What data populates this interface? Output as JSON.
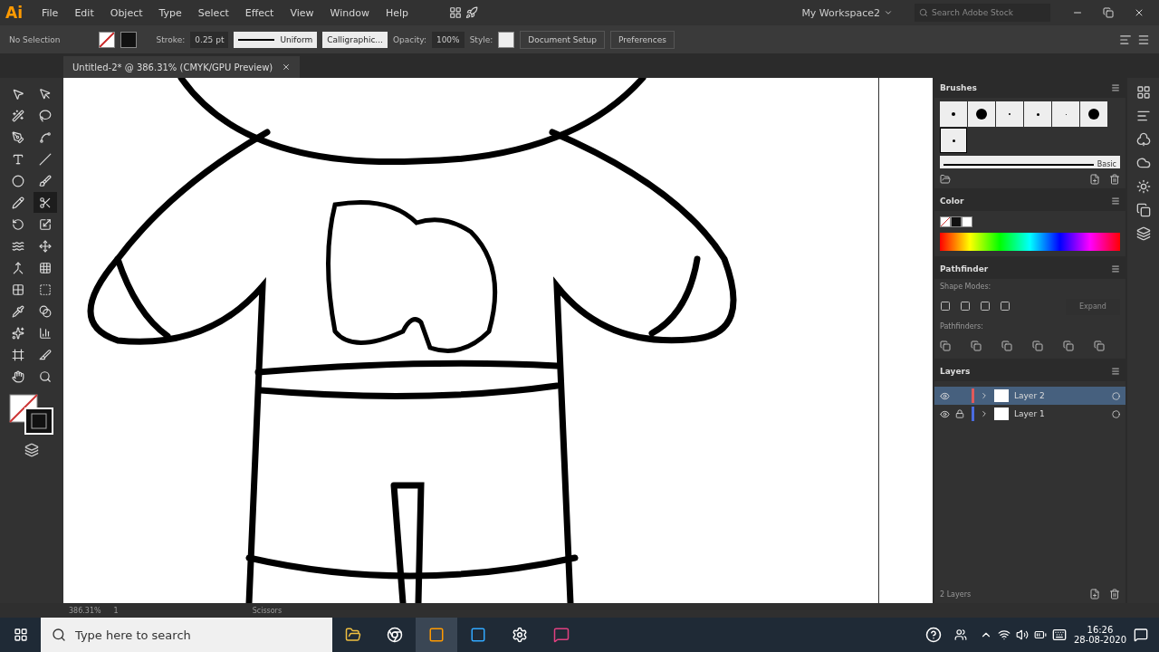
{
  "menu_bar": {
    "logo": "Ai",
    "items": [
      "File",
      "Edit",
      "Object",
      "Type",
      "Select",
      "Effect",
      "View",
      "Window",
      "Help"
    ],
    "workspace": "My Workspace2",
    "search": {
      "placeholder": "Search Adobe Stock"
    }
  },
  "control_bar": {
    "selection": "No Selection",
    "stroke_label": "Stroke:",
    "stroke_value": "0.25 pt",
    "profile": "Uniform",
    "brush": "Calligraphic...",
    "opacity_label": "Opacity:",
    "opacity": "100%",
    "style_label": "Style:",
    "buttons": [
      "Document Setup",
      "Preferences"
    ]
  },
  "document_tab": {
    "title": "Untitled-2* @ 386.31% (CMYK/GPU Preview)"
  },
  "tools": [
    {
      "kind": "select",
      "selected": false
    },
    {
      "kind": "direct",
      "selected": false
    },
    {
      "kind": "wand",
      "selected": false
    },
    {
      "kind": "lasso",
      "selected": false
    },
    {
      "kind": "pen",
      "selected": false
    },
    {
      "kind": "curvature",
      "selected": false
    },
    {
      "kind": "type",
      "selected": false
    },
    {
      "kind": "line",
      "selected": false
    },
    {
      "kind": "ellipse",
      "selected": false
    },
    {
      "kind": "brush",
      "selected": false
    },
    {
      "kind": "pencil",
      "selected": false
    },
    {
      "kind": "scissors",
      "selected": true
    },
    {
      "kind": "rotate",
      "selected": false
    },
    {
      "kind": "scale",
      "selected": false
    },
    {
      "kind": "warp",
      "selected": false
    },
    {
      "kind": "transform",
      "selected": false
    },
    {
      "kind": "shapebuilder",
      "selected": false
    },
    {
      "kind": "perspective",
      "selected": false
    },
    {
      "kind": "mesh",
      "selected": false
    },
    {
      "kind": "gradient",
      "selected": false
    },
    {
      "kind": "eyedropper",
      "selected": false
    },
    {
      "kind": "blend",
      "selected": false
    },
    {
      "kind": "symbol",
      "selected": false
    },
    {
      "kind": "graph",
      "selected": false
    },
    {
      "kind": "artboard",
      "selected": false
    },
    {
      "kind": "slice",
      "selected": false
    },
    {
      "kind": "hand",
      "selected": false
    },
    {
      "kind": "zoom",
      "selected": false
    }
  ],
  "brushes_panel": {
    "title": "Brushes",
    "brush_label": "Basic"
  },
  "color_panel": {
    "title": "Color"
  },
  "pathfinder_panel": {
    "title": "Pathfinder",
    "shape_modes": "Shape Modes:",
    "expand": {
      "label": "Expand",
      "disabled": true
    },
    "pathfinders": "Pathfinders:"
  },
  "layers_panel": {
    "title": "Layers",
    "layers": [
      {
        "name": "Layer 2",
        "selected": true,
        "locked": false,
        "color": "#e05a5a"
      },
      {
        "name": "Layer 1",
        "selected": false,
        "locked": true,
        "color": "#4a6be0"
      }
    ],
    "footer": "2 Layers"
  },
  "status_bar": {
    "zoom": "386.31%",
    "artboard": "1",
    "tool": "Scissors"
  },
  "taskbar": {
    "search": {
      "placeholder": "Type here to search"
    },
    "time": "16:26",
    "date": "28-08-2020"
  }
}
